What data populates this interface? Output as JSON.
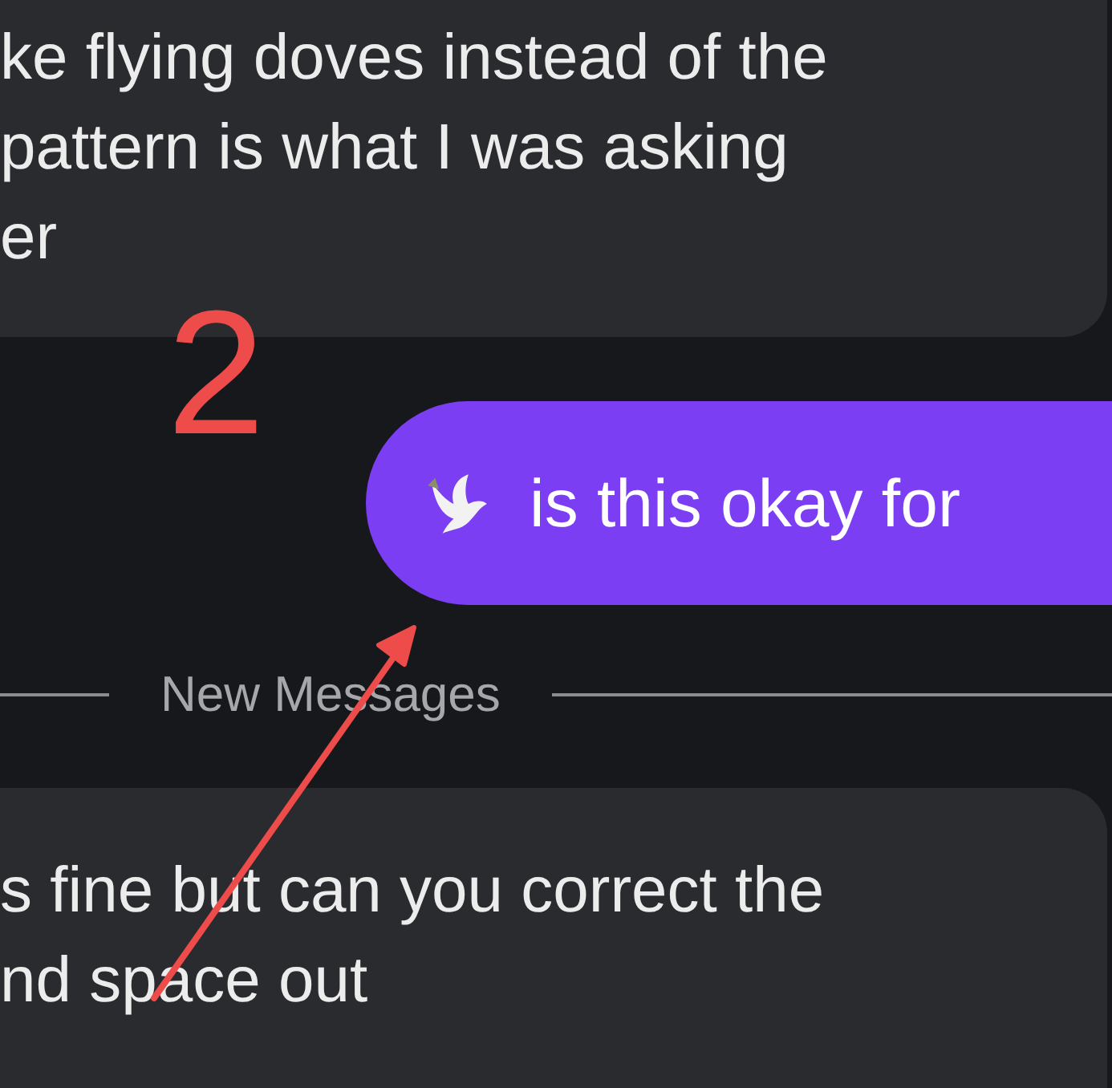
{
  "messages_before": [
    {
      "lines": [
        "ke flying doves instead of the",
        "pattern is what I was asking",
        "er"
      ]
    }
  ],
  "outgoing": {
    "text": "is this okay for"
  },
  "divider": {
    "label": "New Messages"
  },
  "messages_after": [
    {
      "lines": [
        "s fine but can you correct the",
        "nd space out"
      ]
    }
  ],
  "annotation": {
    "number": "2"
  }
}
